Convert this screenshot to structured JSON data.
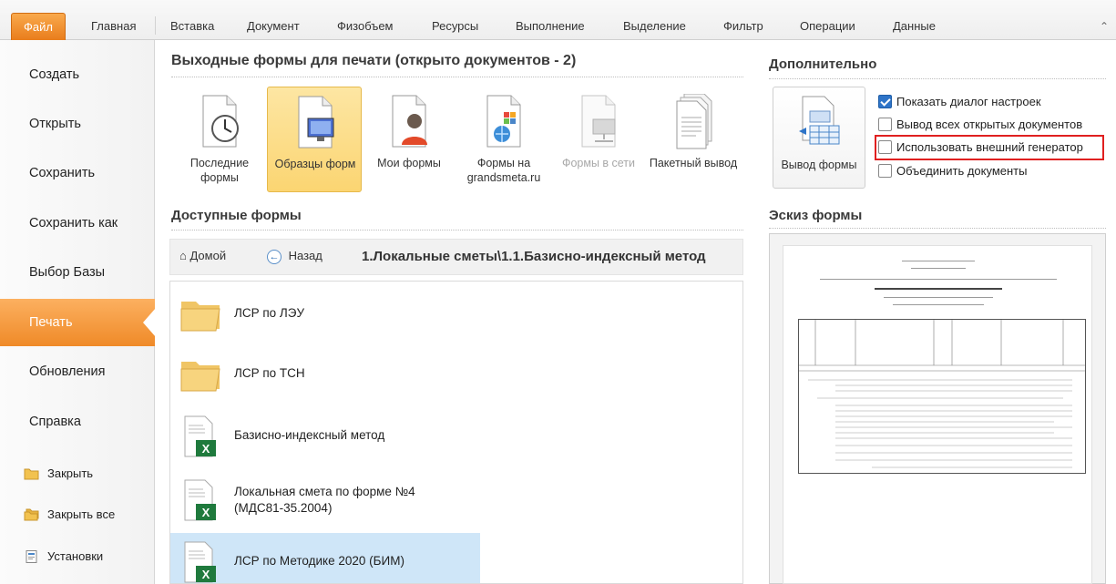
{
  "ribbon": {
    "tabs": [
      "Файл",
      "Главная",
      "Вставка",
      "Документ",
      "Физобъем",
      "Ресурсы",
      "Выполнение",
      "Выделение",
      "Фильтр",
      "Операции",
      "Данные"
    ],
    "help_icon": "help-caret-icon"
  },
  "leftnav": {
    "items": [
      "Создать",
      "Открыть",
      "Сохранить",
      "Сохранить как",
      "Выбор Базы",
      "Печать",
      "Обновления",
      "Справка"
    ],
    "active": "Печать",
    "small_items": [
      {
        "label": "Закрыть",
        "icon": "folder-close-icon"
      },
      {
        "label": "Закрыть все",
        "icon": "folders-close-icon"
      },
      {
        "label": "Установки",
        "icon": "settings-doc-icon"
      }
    ]
  },
  "main": {
    "title": "Выходные формы для печати (открыто документов - 2)",
    "forms": [
      {
        "label": "Последние формы",
        "icon": "clock-doc-icon"
      },
      {
        "label": "Образцы форм",
        "icon": "monitor-doc-icon",
        "selected": true
      },
      {
        "label": "Мои формы",
        "icon": "user-doc-icon"
      },
      {
        "label": "Формы на grandsmeta.ru",
        "icon": "web-doc-icon"
      },
      {
        "label": "Формы в сети",
        "icon": "network-doc-icon",
        "disabled": true
      },
      {
        "label": "Пакетный вывод",
        "icon": "stack-doc-icon"
      }
    ],
    "available_title": "Доступные формы",
    "pathbar": {
      "home": "Домой",
      "back": "Назад",
      "path": "1.Локальные сметы\\1.1.Базисно-индексный метод"
    },
    "files": [
      {
        "name": "ЛСР по ЛЭУ",
        "type": "folder"
      },
      {
        "name": "ЛСР по ТСН",
        "type": "folder"
      },
      {
        "name": "Базисно-индексный метод",
        "type": "excel"
      },
      {
        "name": "Локальная смета по форме №4 (МДС81-35.2004)",
        "type": "excel"
      },
      {
        "name": "ЛСР по Методике 2020 (БИМ)",
        "type": "excel",
        "selected": true
      }
    ]
  },
  "right": {
    "extra_title": "Дополнительно",
    "output_button": "Вывод формы",
    "options": [
      {
        "label": "Показать диалог настроек",
        "checked": true
      },
      {
        "label": "Вывод всех открытых документов",
        "checked": false
      },
      {
        "label": "Использовать внешний генератор",
        "checked": false,
        "highlighted": true
      },
      {
        "label": "Объединить документы",
        "checked": false
      }
    ],
    "preview_title": "Эскиз формы"
  },
  "colors": {
    "accent": "#ef8a28",
    "selection": "#fbd572",
    "highlight": "#e02020",
    "list_selection": "#cfe6f8"
  }
}
